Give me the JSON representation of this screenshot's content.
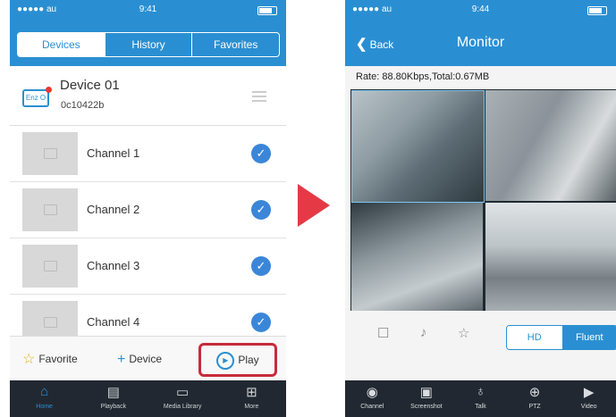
{
  "left": {
    "status": {
      "carrier": "●●●●● au",
      "time": "9:41"
    },
    "tabs": [
      "Devices",
      "History",
      "Favorites"
    ],
    "device": {
      "name": "Device 01",
      "id": "0c10422b",
      "icon_label": "Enz O"
    },
    "channels": [
      "Channel 1",
      "Channel 2",
      "Channel 3",
      "Channel 4"
    ],
    "actions": {
      "favorite": "Favorite",
      "device": "Device",
      "play": "Play"
    },
    "tabbar": [
      {
        "label": "Home",
        "icon": "home-icon"
      },
      {
        "label": "Playback",
        "icon": "film-icon"
      },
      {
        "label": "Media Library",
        "icon": "folder-icon"
      },
      {
        "label": "More",
        "icon": "grid-icon"
      }
    ]
  },
  "right": {
    "status": {
      "carrier": "●●●●● au",
      "time": "9:44"
    },
    "nav": {
      "back": "Back",
      "title": "Monitor"
    },
    "rate": "Rate: 88.80Kbps,Total:0.67MB",
    "quality": {
      "hd": "HD",
      "fluent": "Fluent"
    },
    "tabbar": [
      {
        "label": "Channel",
        "icon": "channel-icon"
      },
      {
        "label": "Screenshot",
        "icon": "camera-icon"
      },
      {
        "label": "Talk",
        "icon": "microphone-icon"
      },
      {
        "label": "PTZ",
        "icon": "ptz-icon"
      },
      {
        "label": "Video",
        "icon": "video-icon"
      }
    ]
  },
  "colors": {
    "primary": "#2a8fd2",
    "highlight": "#c62c3c",
    "arrow": "#e53946",
    "tabbar": "#222831"
  }
}
